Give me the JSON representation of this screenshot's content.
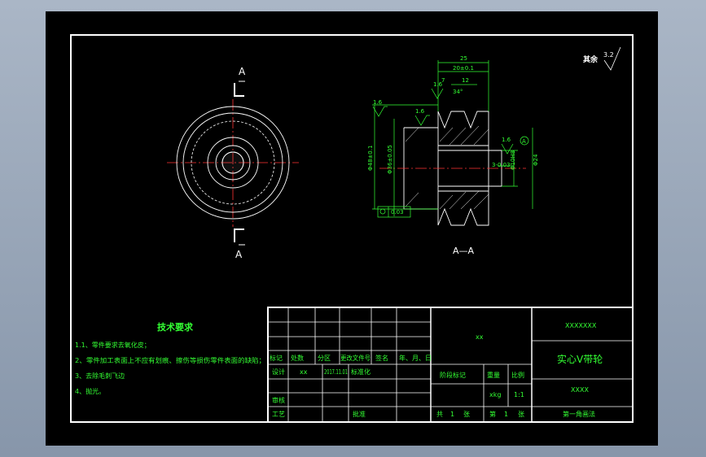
{
  "colors": {
    "outline": "#ffffff",
    "dimension": "#33ff33",
    "centerline": "#ff3333",
    "hidden": "#ffffff"
  },
  "roughness": {
    "label": "其余",
    "value": "3.2"
  },
  "front_view": {
    "section_label_top": "A",
    "section_label_bottom": "A"
  },
  "section_view": {
    "caption": "A—A",
    "dims": {
      "overall": "25",
      "groove_span": "20±0.1",
      "pitch_a": "7",
      "pitch_b": "12",
      "angle": "34°",
      "od": "Φ48±0.1",
      "groove_d": "Φ36±0.05",
      "hub_d": "Φ24",
      "bore_h": "Φ10H8",
      "key": "3-0.03",
      "chamfer": "0.03",
      "flatness": "0.03"
    },
    "roughness_marks": [
      "1.6",
      "1.6",
      "1.6",
      "1.6"
    ],
    "datum": "A"
  },
  "tech_req": {
    "title": "技术要求",
    "items": [
      "1.1、零件要求去氧化皮；",
      "2、零件加工表面上不应有划痕、擦伤等损伤零件表面的缺陷；",
      "3、去除毛刺飞边",
      "4、抛光。"
    ]
  },
  "title_block": {
    "hdr": [
      "标记",
      "处数",
      "分区",
      "更改文件号",
      "签名",
      "年、月、日"
    ],
    "design": "设计",
    "designer": "xx",
    "date": "2017.11.01",
    "std": "标准化",
    "check": "审核",
    "process": "工艺",
    "approve": "批准",
    "stage": "阶段标记",
    "weight": "重量",
    "scale": "比例",
    "weight_val": "xkg",
    "scale_val": "1:1",
    "total": "共",
    "sheets_total": "1",
    "zhang": "张",
    "di": "第",
    "sheet_no": "1",
    "zhang2": "张",
    "material": "xx",
    "company": "XXXXXXX",
    "part_name": "实心V带轮",
    "drawing_no": "XXXX",
    "projection": "第一角画法"
  }
}
